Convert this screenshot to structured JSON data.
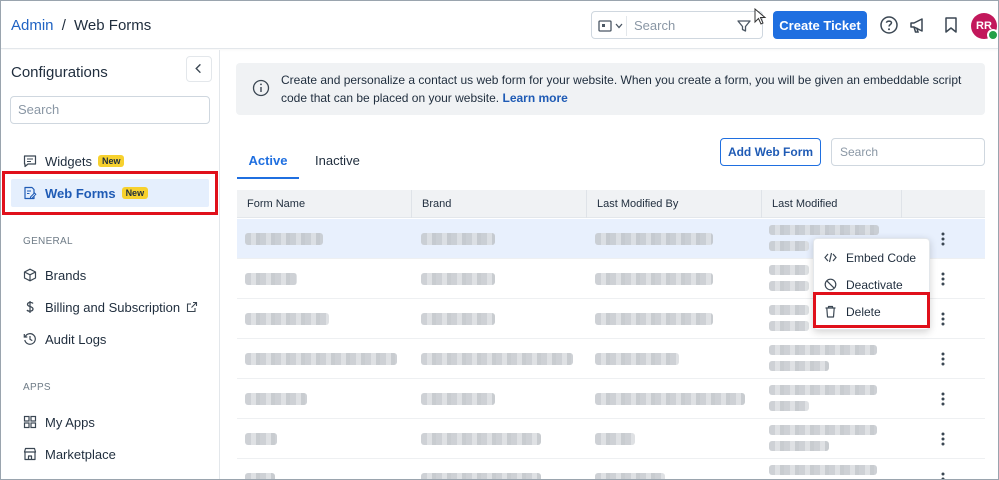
{
  "header": {
    "breadcrumb_root": "Admin",
    "breadcrumb_sep": "/",
    "breadcrumb_page": "Web Forms",
    "search_placeholder": "Search",
    "create_ticket_label": "Create Ticket",
    "avatar_initials": "RR"
  },
  "sidebar": {
    "title": "Configurations",
    "search_placeholder": "Search",
    "items_top": [
      {
        "label": "Widgets",
        "badge": "New",
        "icon": "chat-icon"
      },
      {
        "label": "Web Forms",
        "badge": "New",
        "icon": "form-edit-icon",
        "active": true
      }
    ],
    "section_general": "GENERAL",
    "items_general": [
      {
        "label": "Brands",
        "icon": "cube-icon"
      },
      {
        "label": "Billing and Subscription",
        "icon": "dollar-icon"
      },
      {
        "label": "Audit Logs",
        "icon": "history-icon"
      }
    ],
    "section_apps": "APPS",
    "items_apps": [
      {
        "label": "My Apps",
        "icon": "grid-icon"
      },
      {
        "label": "Marketplace",
        "icon": "store-icon"
      }
    ]
  },
  "info": {
    "text": "Create and personalize a contact us web form for your website. When you create a form, you will be given an embeddable script code that can be placed on your website.",
    "link": "Learn more"
  },
  "tabs": {
    "active": "Active",
    "inactive": "Inactive"
  },
  "toolbar": {
    "add_label": "Add Web Form",
    "search_placeholder": "Search"
  },
  "table": {
    "columns": [
      "Form Name",
      "Brand",
      "Last Modified By",
      "Last Modified"
    ]
  },
  "row_menu": {
    "items": [
      "Embed Code",
      "Deactivate",
      "Delete"
    ]
  },
  "colors": {
    "accent": "#1f6fe0",
    "highlight": "#e0101b",
    "badge": "#f7d12e"
  }
}
